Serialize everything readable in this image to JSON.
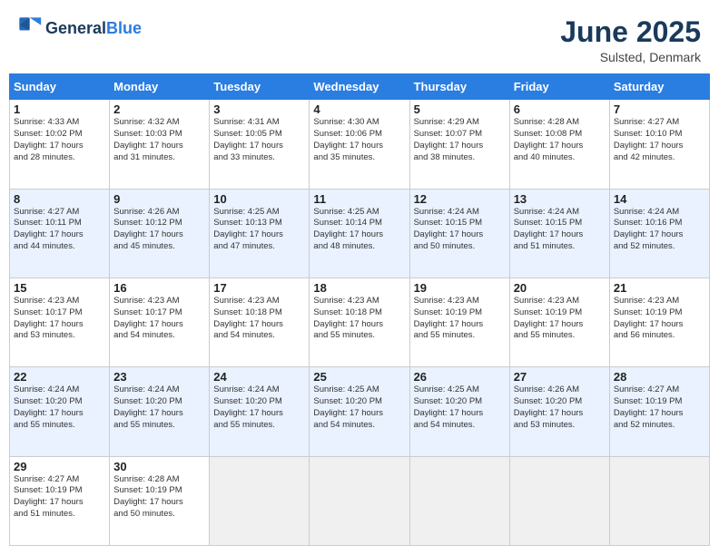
{
  "header": {
    "logo_line1": "General",
    "logo_line2": "Blue",
    "month": "June 2025",
    "location": "Sulsted, Denmark"
  },
  "weekdays": [
    "Sunday",
    "Monday",
    "Tuesday",
    "Wednesday",
    "Thursday",
    "Friday",
    "Saturday"
  ],
  "rows": [
    {
      "cells": [
        {
          "day": "1",
          "info": "Sunrise: 4:33 AM\nSunset: 10:02 PM\nDaylight: 17 hours\nand 28 minutes."
        },
        {
          "day": "2",
          "info": "Sunrise: 4:32 AM\nSunset: 10:03 PM\nDaylight: 17 hours\nand 31 minutes."
        },
        {
          "day": "3",
          "info": "Sunrise: 4:31 AM\nSunset: 10:05 PM\nDaylight: 17 hours\nand 33 minutes."
        },
        {
          "day": "4",
          "info": "Sunrise: 4:30 AM\nSunset: 10:06 PM\nDaylight: 17 hours\nand 35 minutes."
        },
        {
          "day": "5",
          "info": "Sunrise: 4:29 AM\nSunset: 10:07 PM\nDaylight: 17 hours\nand 38 minutes."
        },
        {
          "day": "6",
          "info": "Sunrise: 4:28 AM\nSunset: 10:08 PM\nDaylight: 17 hours\nand 40 minutes."
        },
        {
          "day": "7",
          "info": "Sunrise: 4:27 AM\nSunset: 10:10 PM\nDaylight: 17 hours\nand 42 minutes."
        }
      ]
    },
    {
      "cells": [
        {
          "day": "8",
          "info": "Sunrise: 4:27 AM\nSunset: 10:11 PM\nDaylight: 17 hours\nand 44 minutes."
        },
        {
          "day": "9",
          "info": "Sunrise: 4:26 AM\nSunset: 10:12 PM\nDaylight: 17 hours\nand 45 minutes."
        },
        {
          "day": "10",
          "info": "Sunrise: 4:25 AM\nSunset: 10:13 PM\nDaylight: 17 hours\nand 47 minutes."
        },
        {
          "day": "11",
          "info": "Sunrise: 4:25 AM\nSunset: 10:14 PM\nDaylight: 17 hours\nand 48 minutes."
        },
        {
          "day": "12",
          "info": "Sunrise: 4:24 AM\nSunset: 10:15 PM\nDaylight: 17 hours\nand 50 minutes."
        },
        {
          "day": "13",
          "info": "Sunrise: 4:24 AM\nSunset: 10:15 PM\nDaylight: 17 hours\nand 51 minutes."
        },
        {
          "day": "14",
          "info": "Sunrise: 4:24 AM\nSunset: 10:16 PM\nDaylight: 17 hours\nand 52 minutes."
        }
      ]
    },
    {
      "cells": [
        {
          "day": "15",
          "info": "Sunrise: 4:23 AM\nSunset: 10:17 PM\nDaylight: 17 hours\nand 53 minutes."
        },
        {
          "day": "16",
          "info": "Sunrise: 4:23 AM\nSunset: 10:17 PM\nDaylight: 17 hours\nand 54 minutes."
        },
        {
          "day": "17",
          "info": "Sunrise: 4:23 AM\nSunset: 10:18 PM\nDaylight: 17 hours\nand 54 minutes."
        },
        {
          "day": "18",
          "info": "Sunrise: 4:23 AM\nSunset: 10:18 PM\nDaylight: 17 hours\nand 55 minutes."
        },
        {
          "day": "19",
          "info": "Sunrise: 4:23 AM\nSunset: 10:19 PM\nDaylight: 17 hours\nand 55 minutes."
        },
        {
          "day": "20",
          "info": "Sunrise: 4:23 AM\nSunset: 10:19 PM\nDaylight: 17 hours\nand 55 minutes."
        },
        {
          "day": "21",
          "info": "Sunrise: 4:23 AM\nSunset: 10:19 PM\nDaylight: 17 hours\nand 56 minutes."
        }
      ]
    },
    {
      "cells": [
        {
          "day": "22",
          "info": "Sunrise: 4:24 AM\nSunset: 10:20 PM\nDaylight: 17 hours\nand 55 minutes."
        },
        {
          "day": "23",
          "info": "Sunrise: 4:24 AM\nSunset: 10:20 PM\nDaylight: 17 hours\nand 55 minutes."
        },
        {
          "day": "24",
          "info": "Sunrise: 4:24 AM\nSunset: 10:20 PM\nDaylight: 17 hours\nand 55 minutes."
        },
        {
          "day": "25",
          "info": "Sunrise: 4:25 AM\nSunset: 10:20 PM\nDaylight: 17 hours\nand 54 minutes."
        },
        {
          "day": "26",
          "info": "Sunrise: 4:25 AM\nSunset: 10:20 PM\nDaylight: 17 hours\nand 54 minutes."
        },
        {
          "day": "27",
          "info": "Sunrise: 4:26 AM\nSunset: 10:20 PM\nDaylight: 17 hours\nand 53 minutes."
        },
        {
          "day": "28",
          "info": "Sunrise: 4:27 AM\nSunset: 10:19 PM\nDaylight: 17 hours\nand 52 minutes."
        }
      ]
    },
    {
      "cells": [
        {
          "day": "29",
          "info": "Sunrise: 4:27 AM\nSunset: 10:19 PM\nDaylight: 17 hours\nand 51 minutes."
        },
        {
          "day": "30",
          "info": "Sunrise: 4:28 AM\nSunset: 10:19 PM\nDaylight: 17 hours\nand 50 minutes."
        },
        {
          "day": "",
          "info": ""
        },
        {
          "day": "",
          "info": ""
        },
        {
          "day": "",
          "info": ""
        },
        {
          "day": "",
          "info": ""
        },
        {
          "day": "",
          "info": ""
        }
      ]
    }
  ]
}
